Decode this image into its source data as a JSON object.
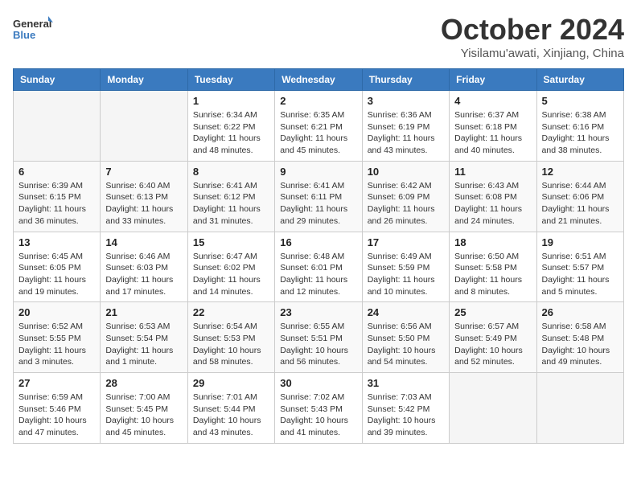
{
  "header": {
    "logo_general": "General",
    "logo_blue": "Blue",
    "month_title": "October 2024",
    "subtitle": "Yisilamu'awati, Xinjiang, China"
  },
  "weekdays": [
    "Sunday",
    "Monday",
    "Tuesday",
    "Wednesday",
    "Thursday",
    "Friday",
    "Saturday"
  ],
  "weeks": [
    [
      {
        "day": "",
        "info": ""
      },
      {
        "day": "",
        "info": ""
      },
      {
        "day": "1",
        "info": "Sunrise: 6:34 AM\nSunset: 6:22 PM\nDaylight: 11 hours and 48 minutes."
      },
      {
        "day": "2",
        "info": "Sunrise: 6:35 AM\nSunset: 6:21 PM\nDaylight: 11 hours and 45 minutes."
      },
      {
        "day": "3",
        "info": "Sunrise: 6:36 AM\nSunset: 6:19 PM\nDaylight: 11 hours and 43 minutes."
      },
      {
        "day": "4",
        "info": "Sunrise: 6:37 AM\nSunset: 6:18 PM\nDaylight: 11 hours and 40 minutes."
      },
      {
        "day": "5",
        "info": "Sunrise: 6:38 AM\nSunset: 6:16 PM\nDaylight: 11 hours and 38 minutes."
      }
    ],
    [
      {
        "day": "6",
        "info": "Sunrise: 6:39 AM\nSunset: 6:15 PM\nDaylight: 11 hours and 36 minutes."
      },
      {
        "day": "7",
        "info": "Sunrise: 6:40 AM\nSunset: 6:13 PM\nDaylight: 11 hours and 33 minutes."
      },
      {
        "day": "8",
        "info": "Sunrise: 6:41 AM\nSunset: 6:12 PM\nDaylight: 11 hours and 31 minutes."
      },
      {
        "day": "9",
        "info": "Sunrise: 6:41 AM\nSunset: 6:11 PM\nDaylight: 11 hours and 29 minutes."
      },
      {
        "day": "10",
        "info": "Sunrise: 6:42 AM\nSunset: 6:09 PM\nDaylight: 11 hours and 26 minutes."
      },
      {
        "day": "11",
        "info": "Sunrise: 6:43 AM\nSunset: 6:08 PM\nDaylight: 11 hours and 24 minutes."
      },
      {
        "day": "12",
        "info": "Sunrise: 6:44 AM\nSunset: 6:06 PM\nDaylight: 11 hours and 21 minutes."
      }
    ],
    [
      {
        "day": "13",
        "info": "Sunrise: 6:45 AM\nSunset: 6:05 PM\nDaylight: 11 hours and 19 minutes."
      },
      {
        "day": "14",
        "info": "Sunrise: 6:46 AM\nSunset: 6:03 PM\nDaylight: 11 hours and 17 minutes."
      },
      {
        "day": "15",
        "info": "Sunrise: 6:47 AM\nSunset: 6:02 PM\nDaylight: 11 hours and 14 minutes."
      },
      {
        "day": "16",
        "info": "Sunrise: 6:48 AM\nSunset: 6:01 PM\nDaylight: 11 hours and 12 minutes."
      },
      {
        "day": "17",
        "info": "Sunrise: 6:49 AM\nSunset: 5:59 PM\nDaylight: 11 hours and 10 minutes."
      },
      {
        "day": "18",
        "info": "Sunrise: 6:50 AM\nSunset: 5:58 PM\nDaylight: 11 hours and 8 minutes."
      },
      {
        "day": "19",
        "info": "Sunrise: 6:51 AM\nSunset: 5:57 PM\nDaylight: 11 hours and 5 minutes."
      }
    ],
    [
      {
        "day": "20",
        "info": "Sunrise: 6:52 AM\nSunset: 5:55 PM\nDaylight: 11 hours and 3 minutes."
      },
      {
        "day": "21",
        "info": "Sunrise: 6:53 AM\nSunset: 5:54 PM\nDaylight: 11 hours and 1 minute."
      },
      {
        "day": "22",
        "info": "Sunrise: 6:54 AM\nSunset: 5:53 PM\nDaylight: 10 hours and 58 minutes."
      },
      {
        "day": "23",
        "info": "Sunrise: 6:55 AM\nSunset: 5:51 PM\nDaylight: 10 hours and 56 minutes."
      },
      {
        "day": "24",
        "info": "Sunrise: 6:56 AM\nSunset: 5:50 PM\nDaylight: 10 hours and 54 minutes."
      },
      {
        "day": "25",
        "info": "Sunrise: 6:57 AM\nSunset: 5:49 PM\nDaylight: 10 hours and 52 minutes."
      },
      {
        "day": "26",
        "info": "Sunrise: 6:58 AM\nSunset: 5:48 PM\nDaylight: 10 hours and 49 minutes."
      }
    ],
    [
      {
        "day": "27",
        "info": "Sunrise: 6:59 AM\nSunset: 5:46 PM\nDaylight: 10 hours and 47 minutes."
      },
      {
        "day": "28",
        "info": "Sunrise: 7:00 AM\nSunset: 5:45 PM\nDaylight: 10 hours and 45 minutes."
      },
      {
        "day": "29",
        "info": "Sunrise: 7:01 AM\nSunset: 5:44 PM\nDaylight: 10 hours and 43 minutes."
      },
      {
        "day": "30",
        "info": "Sunrise: 7:02 AM\nSunset: 5:43 PM\nDaylight: 10 hours and 41 minutes."
      },
      {
        "day": "31",
        "info": "Sunrise: 7:03 AM\nSunset: 5:42 PM\nDaylight: 10 hours and 39 minutes."
      },
      {
        "day": "",
        "info": ""
      },
      {
        "day": "",
        "info": ""
      }
    ]
  ]
}
